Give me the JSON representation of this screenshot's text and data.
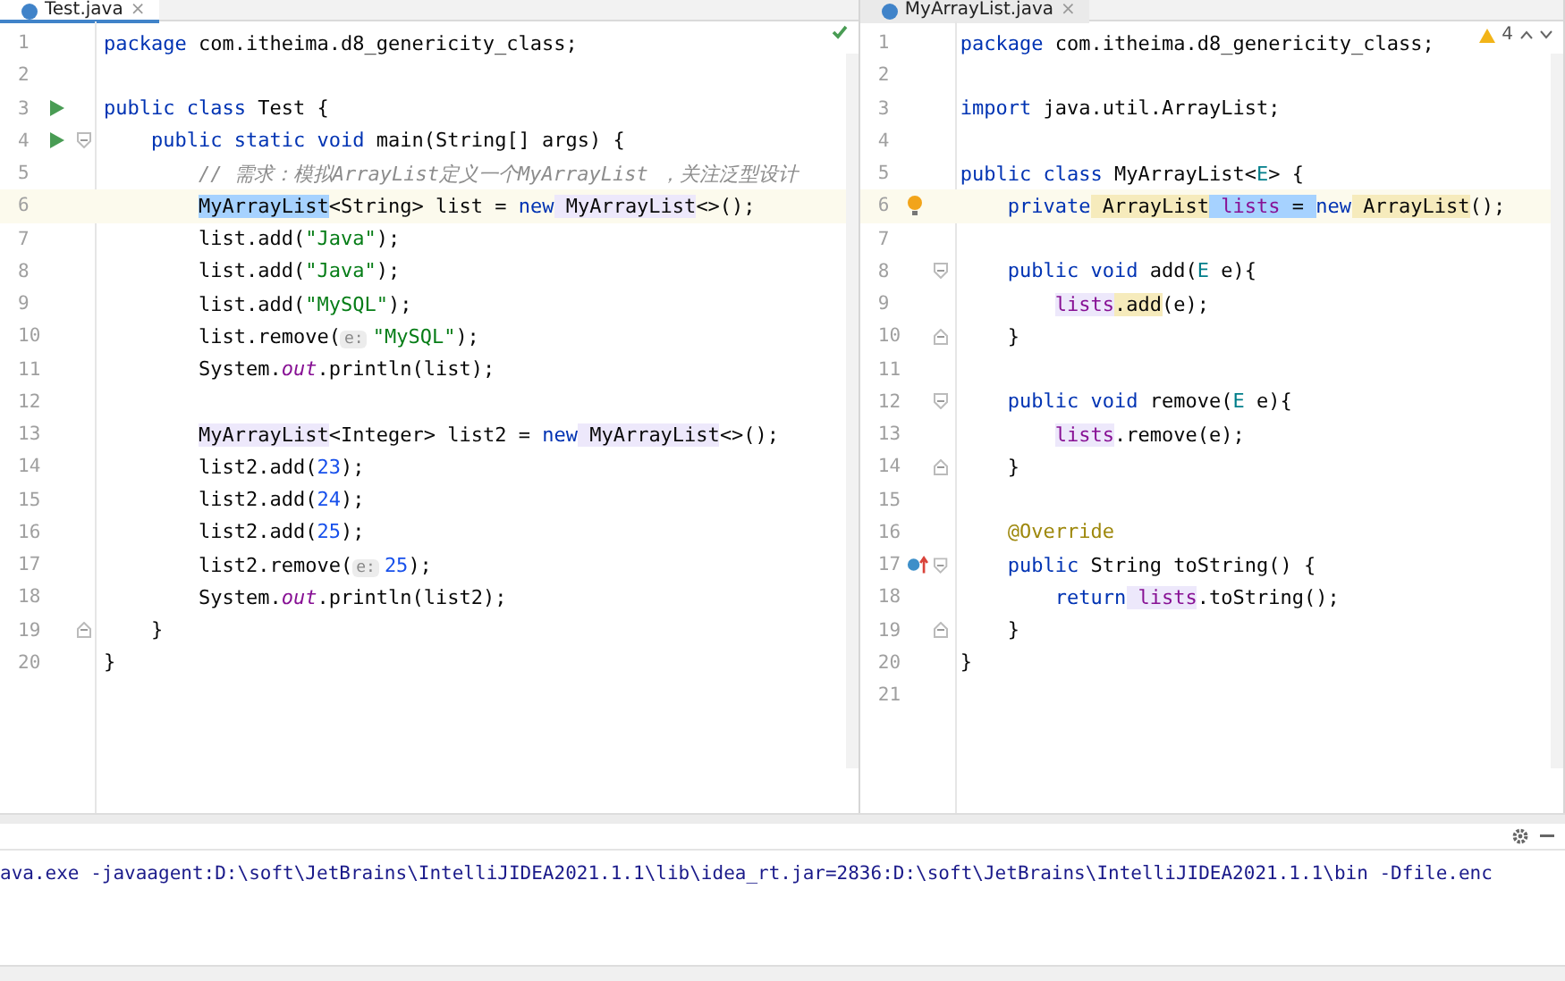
{
  "editors": [
    {
      "tab": {
        "label": "Test.java",
        "close": "×",
        "selected": true
      },
      "status": {
        "kind": "ok"
      },
      "lines": [
        {
          "number": "1",
          "tokens": [
            {
              "text": "package",
              "kind": "keyword"
            },
            {
              "text": " com.itheima.d8_genericity_class;",
              "kind": "plain"
            }
          ]
        },
        {
          "number": "2"
        },
        {
          "number": "3",
          "gutter": {
            "kind": "run"
          },
          "tokens": [
            {
              "text": "public class",
              "kind": "keyword"
            },
            {
              "text": " Test {",
              "kind": "plain"
            }
          ],
          "children": [
            {
              "number": "4",
              "gutter": {
                "kind": "run"
              },
              "fold": {
                "kind": "start"
              },
              "tokens": [
                {
                  "text": "public static void",
                  "kind": "keyword"
                },
                {
                  "text": " main(String[] args) {",
                  "kind": "plain"
                }
              ],
              "children": [
                {
                  "number": "5",
                  "tokens": [
                    {
                      "text": "// 需求：模拟ArrayList定义一个MyArrayList ，关注泛型设计",
                      "kind": "comment"
                    }
                  ]
                },
                {
                  "number": "6",
                  "current": true,
                  "tokens": [
                    {
                      "text": "MyArrayList",
                      "kind": "plain",
                      "highlight": {
                        "kind": "selected"
                      }
                    },
                    {
                      "text": "<String> list = ",
                      "kind": "plain"
                    },
                    {
                      "text": "new",
                      "kind": "keyword"
                    },
                    {
                      "text": " MyArrayList",
                      "kind": "plain",
                      "highlight": {
                        "kind": "usage"
                      }
                    },
                    {
                      "text": "<>();",
                      "kind": "plain"
                    }
                  ]
                },
                {
                  "number": "7",
                  "tokens": [
                    {
                      "text": "list.add(",
                      "kind": "plain"
                    },
                    {
                      "text": "\"Java\"",
                      "kind": "string"
                    },
                    {
                      "text": ");",
                      "kind": "plain"
                    }
                  ]
                },
                {
                  "number": "8",
                  "tokens": [
                    {
                      "text": "list.add(",
                      "kind": "plain"
                    },
                    {
                      "text": "\"Java\"",
                      "kind": "string"
                    },
                    {
                      "text": ");",
                      "kind": "plain"
                    }
                  ]
                },
                {
                  "number": "9",
                  "tokens": [
                    {
                      "text": "list.add(",
                      "kind": "plain"
                    },
                    {
                      "text": "\"MySQL\"",
                      "kind": "string"
                    },
                    {
                      "text": ");",
                      "kind": "plain"
                    }
                  ]
                },
                {
                  "number": "10",
                  "tokens": [
                    {
                      "text": "list.remove(",
                      "kind": "plain"
                    },
                    {
                      "text": "e:",
                      "kind": "hint"
                    },
                    {
                      "text": "\"MySQL\"",
                      "kind": "string"
                    },
                    {
                      "text": ");",
                      "kind": "plain"
                    }
                  ]
                },
                {
                  "number": "11",
                  "tokens": [
                    {
                      "text": "System.",
                      "kind": "plain"
                    },
                    {
                      "text": "out",
                      "kind": "static"
                    },
                    {
                      "text": ".println(list);",
                      "kind": "plain"
                    }
                  ]
                },
                {
                  "number": "12"
                },
                {
                  "number": "13",
                  "tokens": [
                    {
                      "text": "MyArrayList",
                      "kind": "plain",
                      "highlight": {
                        "kind": "usage"
                      }
                    },
                    {
                      "text": "<Integer> list2 = ",
                      "kind": "plain"
                    },
                    {
                      "text": "new",
                      "kind": "keyword"
                    },
                    {
                      "text": " MyArrayList",
                      "kind": "plain",
                      "highlight": {
                        "kind": "usage"
                      }
                    },
                    {
                      "text": "<>();",
                      "kind": "plain"
                    }
                  ]
                },
                {
                  "number": "14",
                  "tokens": [
                    {
                      "text": "list2.add(",
                      "kind": "plain"
                    },
                    {
                      "text": "23",
                      "kind": "number"
                    },
                    {
                      "text": ");",
                      "kind": "plain"
                    }
                  ]
                },
                {
                  "number": "15",
                  "tokens": [
                    {
                      "text": "list2.add(",
                      "kind": "plain"
                    },
                    {
                      "text": "24",
                      "kind": "number"
                    },
                    {
                      "text": ");",
                      "kind": "plain"
                    }
                  ]
                },
                {
                  "number": "16",
                  "tokens": [
                    {
                      "text": "list2.add(",
                      "kind": "plain"
                    },
                    {
                      "text": "25",
                      "kind": "number"
                    },
                    {
                      "text": ");",
                      "kind": "plain"
                    }
                  ]
                },
                {
                  "number": "17",
                  "tokens": [
                    {
                      "text": "list2.remove(",
                      "kind": "plain"
                    },
                    {
                      "text": "e:",
                      "kind": "hint"
                    },
                    {
                      "text": "25",
                      "kind": "number"
                    },
                    {
                      "text": ");",
                      "kind": "plain"
                    }
                  ]
                },
                {
                  "number": "18",
                  "tokens": [
                    {
                      "text": "System.",
                      "kind": "plain"
                    },
                    {
                      "text": "out",
                      "kind": "static"
                    },
                    {
                      "text": ".println(list2);",
                      "kind": "plain"
                    }
                  ]
                }
              ]
            },
            {
              "number": "19",
              "fold": {
                "kind": "end"
              },
              "tokens": [
                {
                  "text": "}",
                  "kind": "plain"
                }
              ]
            }
          ]
        },
        {
          "number": "20",
          "tokens": [
            {
              "text": "}",
              "kind": "plain"
            }
          ]
        }
      ]
    },
    {
      "tab": {
        "label": "MyArrayList.java",
        "close": "×",
        "selected": false
      },
      "status": {
        "kind": "warnings",
        "count": "4"
      },
      "lines": [
        {
          "number": "1",
          "tokens": [
            {
              "text": "package",
              "kind": "keyword"
            },
            {
              "text": " com.itheima.d8_genericity_class;",
              "kind": "plain"
            }
          ]
        },
        {
          "number": "2"
        },
        {
          "number": "3",
          "tokens": [
            {
              "text": "import",
              "kind": "keyword"
            },
            {
              "text": " java.util.ArrayList;",
              "kind": "plain"
            }
          ]
        },
        {
          "number": "4"
        },
        {
          "number": "5",
          "tokens": [
            {
              "text": "public class",
              "kind": "keyword"
            },
            {
              "text": " MyArrayList<",
              "kind": "plain"
            },
            {
              "text": "E",
              "kind": "typeparam"
            },
            {
              "text": "> {",
              "kind": "plain"
            }
          ],
          "children": [
            {
              "number": "6",
              "current": true,
              "gutter": {
                "kind": "bulb"
              },
              "tokens": [
                {
                  "text": "private",
                  "kind": "keyword"
                },
                {
                  "text": " ArrayList",
                  "kind": "plain",
                  "highlight": {
                    "kind": "warn"
                  }
                },
                {
                  "text": " lists",
                  "kind": "field",
                  "highlight": {
                    "kind": "selected"
                  }
                },
                {
                  "text": " = ",
                  "kind": "plain",
                  "highlight": {
                    "kind": "selected"
                  }
                },
                {
                  "text": "new",
                  "kind": "keyword"
                },
                {
                  "text": " ArrayList",
                  "kind": "plain",
                  "highlight": {
                    "kind": "warn"
                  }
                },
                {
                  "text": "();",
                  "kind": "plain"
                }
              ]
            },
            {
              "number": "7"
            },
            {
              "number": "8",
              "fold": {
                "kind": "start"
              },
              "tokens": [
                {
                  "text": "public void",
                  "kind": "keyword"
                },
                {
                  "text": " add(",
                  "kind": "plain"
                },
                {
                  "text": "E",
                  "kind": "typeparam"
                },
                {
                  "text": " e){",
                  "kind": "plain"
                }
              ],
              "children": [
                {
                  "number": "9",
                  "tokens": [
                    {
                      "text": "lists",
                      "kind": "field",
                      "highlight": {
                        "kind": "usage"
                      }
                    },
                    {
                      "text": ".add",
                      "kind": "plain",
                      "highlight": {
                        "kind": "warn"
                      }
                    },
                    {
                      "text": "(e);",
                      "kind": "plain"
                    }
                  ]
                }
              ]
            },
            {
              "number": "10",
              "fold": {
                "kind": "end"
              },
              "tokens": [
                {
                  "text": "}",
                  "kind": "plain"
                }
              ]
            },
            {
              "number": "11"
            },
            {
              "number": "12",
              "fold": {
                "kind": "start"
              },
              "tokens": [
                {
                  "text": "public void",
                  "kind": "keyword"
                },
                {
                  "text": " remove(",
                  "kind": "plain"
                },
                {
                  "text": "E",
                  "kind": "typeparam"
                },
                {
                  "text": " e){",
                  "kind": "plain"
                }
              ],
              "children": [
                {
                  "number": "13",
                  "tokens": [
                    {
                      "text": "lists",
                      "kind": "field",
                      "highlight": {
                        "kind": "usage"
                      }
                    },
                    {
                      "text": ".remove(e);",
                      "kind": "plain"
                    }
                  ]
                }
              ]
            },
            {
              "number": "14",
              "fold": {
                "kind": "end"
              },
              "tokens": [
                {
                  "text": "}",
                  "kind": "plain"
                }
              ]
            },
            {
              "number": "15"
            },
            {
              "number": "16",
              "tokens": [
                {
                  "text": "@Override",
                  "kind": "annotation"
                }
              ]
            },
            {
              "number": "17",
              "gutter": {
                "kind": "override"
              },
              "fold": {
                "kind": "start"
              },
              "tokens": [
                {
                  "text": "public",
                  "kind": "keyword"
                },
                {
                  "text": " String toString() {",
                  "kind": "plain"
                }
              ],
              "children": [
                {
                  "number": "18",
                  "tokens": [
                    {
                      "text": "return",
                      "kind": "keyword"
                    },
                    {
                      "text": " lists",
                      "kind": "field",
                      "highlight": {
                        "kind": "usage"
                      }
                    },
                    {
                      "text": ".toString();",
                      "kind": "plain"
                    }
                  ]
                }
              ]
            },
            {
              "number": "19",
              "fold": {
                "kind": "end"
              },
              "tokens": [
                {
                  "text": "}",
                  "kind": "plain"
                }
              ]
            }
          ]
        },
        {
          "number": "20",
          "tokens": [
            {
              "text": "}",
              "kind": "plain"
            }
          ]
        },
        {
          "number": "21"
        }
      ]
    }
  ],
  "console": {
    "output": "ava.exe -javaagent:D:\\soft\\JetBrains\\IntelliJIDEA2021.1.1\\lib\\idea_rt.jar=2836:D:\\soft\\JetBrains\\IntelliJIDEA2021.1.1\\bin -Dfile.enc"
  }
}
